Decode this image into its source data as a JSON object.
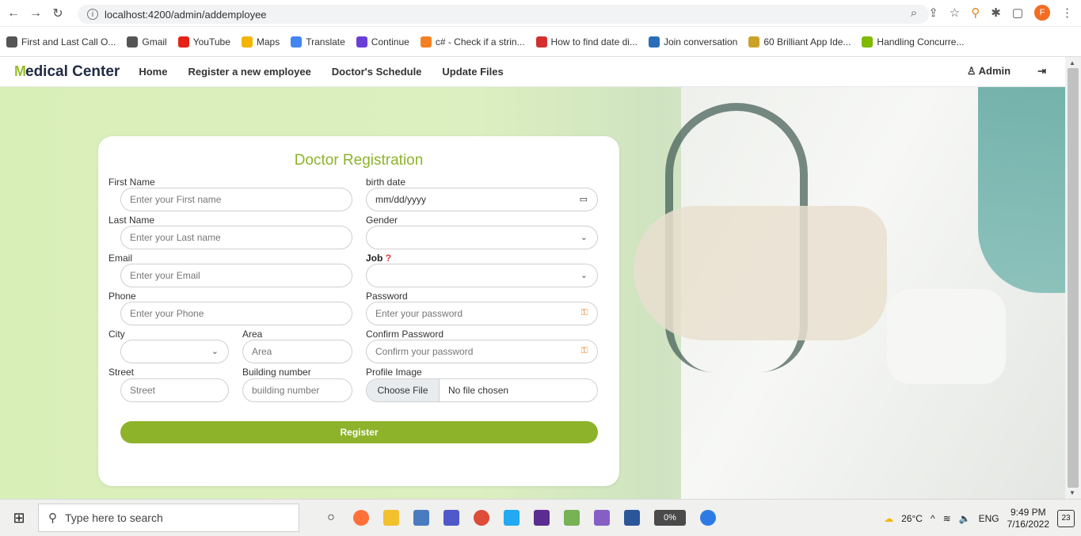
{
  "browser": {
    "url": "localhost:4200/admin/addemployee",
    "profile_initial": "F",
    "bookmarks": [
      {
        "label": "First and Last Call O...",
        "color": "#555555"
      },
      {
        "label": "Gmail",
        "color": "#555555"
      },
      {
        "label": "YouTube",
        "color": "#e62117"
      },
      {
        "label": "Maps",
        "color": "#f4b400"
      },
      {
        "label": "Translate",
        "color": "#4285f4"
      },
      {
        "label": "Continue",
        "color": "#6a3fd6"
      },
      {
        "label": "c# - Check if a strin...",
        "color": "#f48024"
      },
      {
        "label": "How to find date di...",
        "color": "#d32f2f"
      },
      {
        "label": "Join conversation",
        "color": "#2a6ebb"
      },
      {
        "label": "60 Brilliant App Ide...",
        "color": "#c9a227"
      },
      {
        "label": "Handling Concurre...",
        "color": "#7fba00"
      }
    ]
  },
  "app": {
    "brand": "edical Center",
    "brand_logo": "M",
    "nav": {
      "home": "Home",
      "register": "Register a new employee",
      "schedule": "Doctor's Schedule",
      "update_files": "Update Files",
      "admin": "Admin"
    }
  },
  "form": {
    "title": "Doctor Registration",
    "first_name": {
      "label": "First Name",
      "placeholder": "Enter your First name"
    },
    "last_name": {
      "label": "Last Name",
      "placeholder": "Enter your Last name"
    },
    "email": {
      "label": "Email",
      "placeholder": "Enter your Email"
    },
    "phone": {
      "label": "Phone",
      "placeholder": "Enter your Phone"
    },
    "city": {
      "label": "City"
    },
    "area": {
      "label": "Area",
      "placeholder": "Area"
    },
    "street": {
      "label": "Street",
      "placeholder": "Street"
    },
    "building": {
      "label": "Building number",
      "placeholder": "building number"
    },
    "birth_date": {
      "label": "birth date",
      "placeholder": "mm/dd/yyyy"
    },
    "gender": {
      "label": "Gender"
    },
    "job": {
      "label": "Job",
      "required_mark": "?"
    },
    "password": {
      "label": "Password",
      "placeholder": "Enter your password"
    },
    "confirm_password": {
      "label": "Confirm Password",
      "placeholder": "Confirm your password"
    },
    "profile_image": {
      "label": "Profile Image",
      "button": "Choose File",
      "status": "No file chosen"
    },
    "register_button": "Register"
  },
  "taskbar": {
    "search_placeholder": "Type here to search",
    "battery": "0%",
    "weather": "26°C",
    "language": "ENG",
    "time": "9:49 PM",
    "date": "7/16/2022",
    "notifications": "23"
  }
}
